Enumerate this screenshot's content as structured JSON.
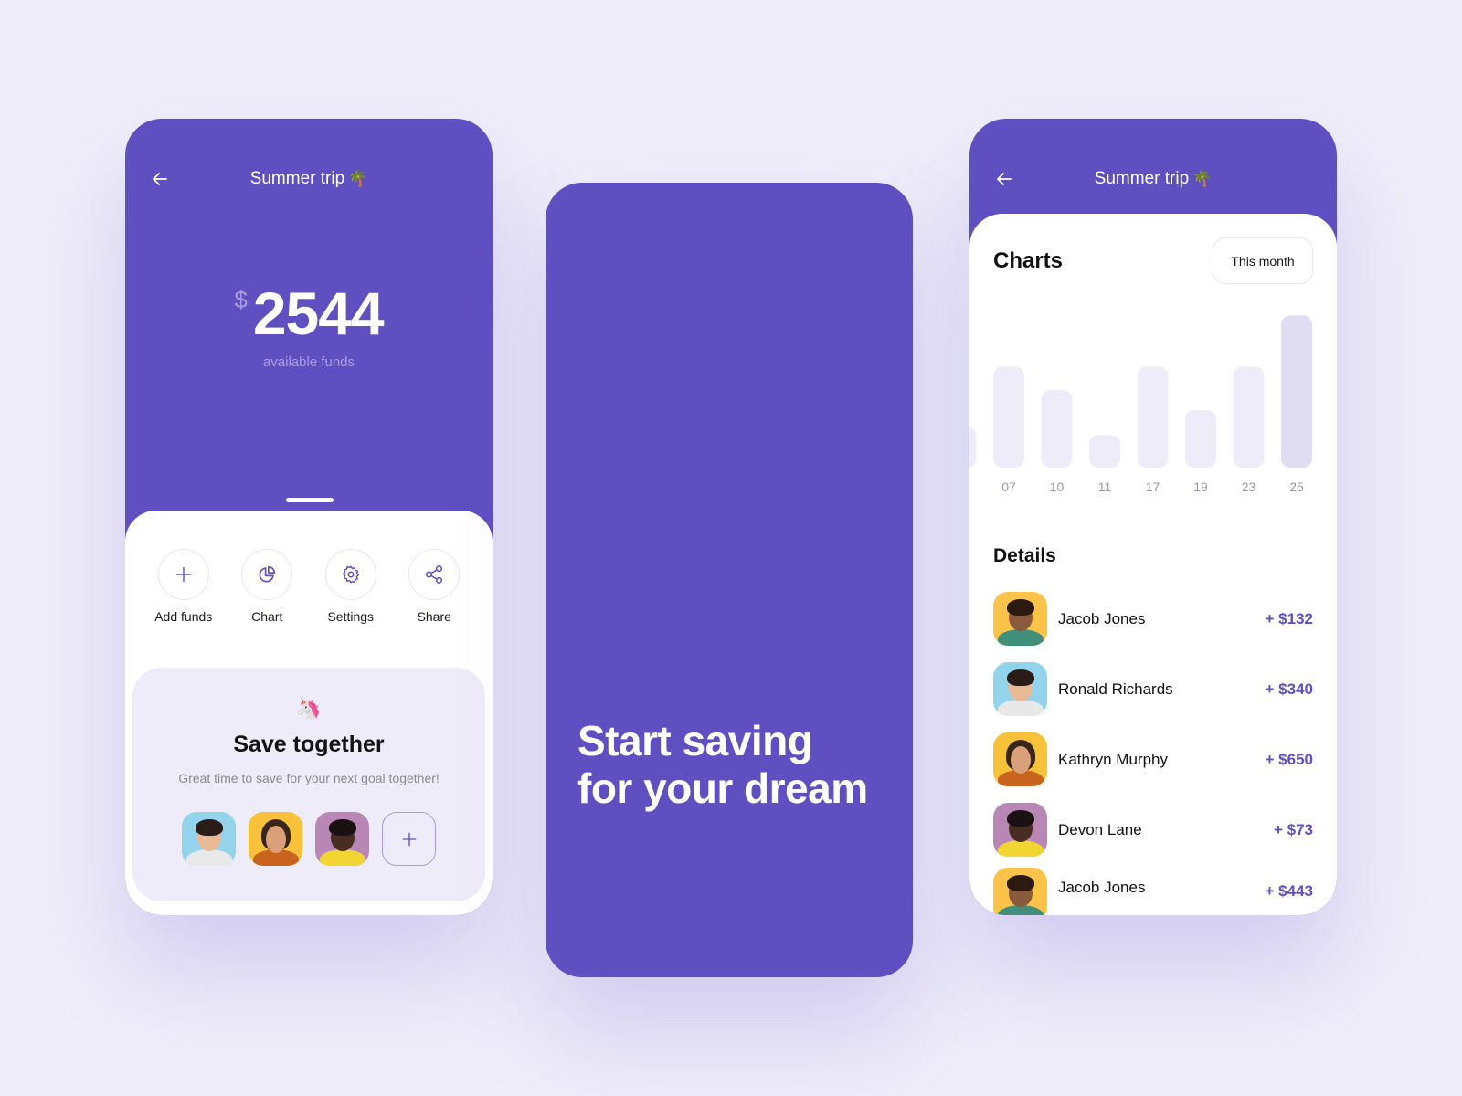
{
  "colors": {
    "brand": "#5f4fc0",
    "background": "#efedf9",
    "bar": "#efecf9",
    "bar_active": "#e0dcf2",
    "amount": "#5f4fc0"
  },
  "left_screen": {
    "title": "Summer trip",
    "title_emoji": "🌴",
    "back_icon": "arrow-left-icon",
    "balance": {
      "currency": "$",
      "amount": "2544",
      "label": "available funds"
    },
    "actions": [
      {
        "label": "Add funds",
        "icon": "plus-icon"
      },
      {
        "label": "Chart",
        "icon": "pie-chart-icon"
      },
      {
        "label": "Settings",
        "icon": "gear-icon"
      },
      {
        "label": "Share",
        "icon": "share-icon"
      }
    ],
    "promo": {
      "emoji": "🦄",
      "title": "Save together",
      "subtitle": "Great time to save for your next goal together!",
      "members": [
        "Ronald Richards",
        "Kathryn Murphy",
        "Devon Lane"
      ],
      "add_icon": "plus-icon"
    }
  },
  "middle_screen": {
    "headline": "Start saving for your dream"
  },
  "right_screen": {
    "title": "Summer trip",
    "title_emoji": "🌴",
    "back_icon": "arrow-left-icon",
    "charts_heading": "Charts",
    "period_button": "This month",
    "details_heading": "Details",
    "details": [
      {
        "name": "Jacob Jones",
        "amount": "+ $132"
      },
      {
        "name": "Ronald Richards",
        "amount": "+ $340"
      },
      {
        "name": "Kathryn Murphy",
        "amount": "+ $650"
      },
      {
        "name": "Devon Lane",
        "amount": "+ $73"
      },
      {
        "name": "Jacob Jones",
        "amount": "+ $443"
      }
    ]
  },
  "chart_data": {
    "type": "bar",
    "title": "Charts",
    "categories": [
      "07",
      "10",
      "11",
      "17",
      "19",
      "23",
      "25"
    ],
    "values": [
      65,
      50,
      21,
      65,
      37,
      65,
      98
    ],
    "highlighted": "25",
    "partial_leading_value": 26,
    "ylim": [
      0,
      100
    ],
    "xlabel": "",
    "ylabel": "",
    "grid": false,
    "legend": "none"
  }
}
